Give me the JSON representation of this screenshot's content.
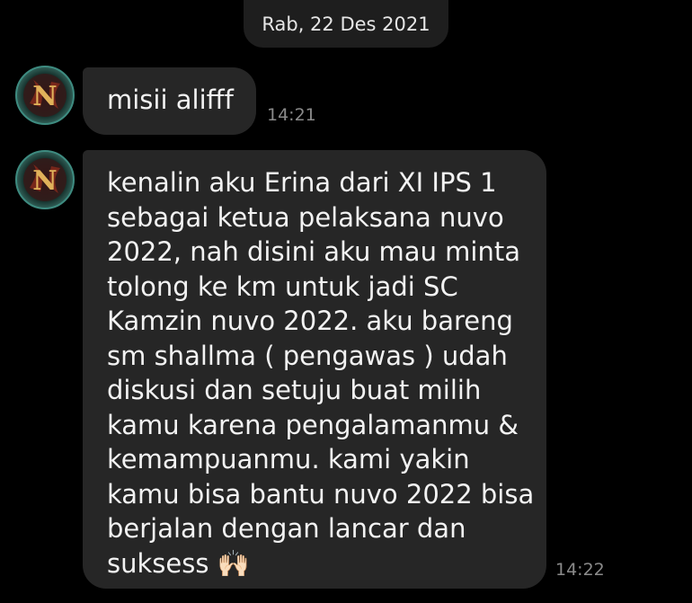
{
  "date_separator": "Rab, 22 Des 2021",
  "avatar_icon": "avatar-letter-n-icon",
  "colors": {
    "background": "#000000",
    "bubble": "#262626",
    "text": "#f2f2f2",
    "timestamp": "#8a8a8a"
  },
  "messages": [
    {
      "lines": [
        "misii alifff"
      ],
      "time": "14:21"
    },
    {
      "lines": [
        "kenalin aku Erina dari XI IPS 1",
        "sebagai ketua pelaksana nuvo",
        "2022, nah disini aku mau minta",
        "tolong ke km untuk jadi SC",
        "Kamzin nuvo 2022. aku bareng",
        "sm shallma ( pengawas ) udah",
        "diskusi dan setuju buat milih",
        "kamu karena pengalamanmu &",
        "kemampuanmu. kami yakin",
        "kamu bisa bantu nuvo 2022 bisa",
        "berjalan dengan lancar dan",
        "suksess 🙌🏻"
      ],
      "time": "14:22"
    }
  ]
}
